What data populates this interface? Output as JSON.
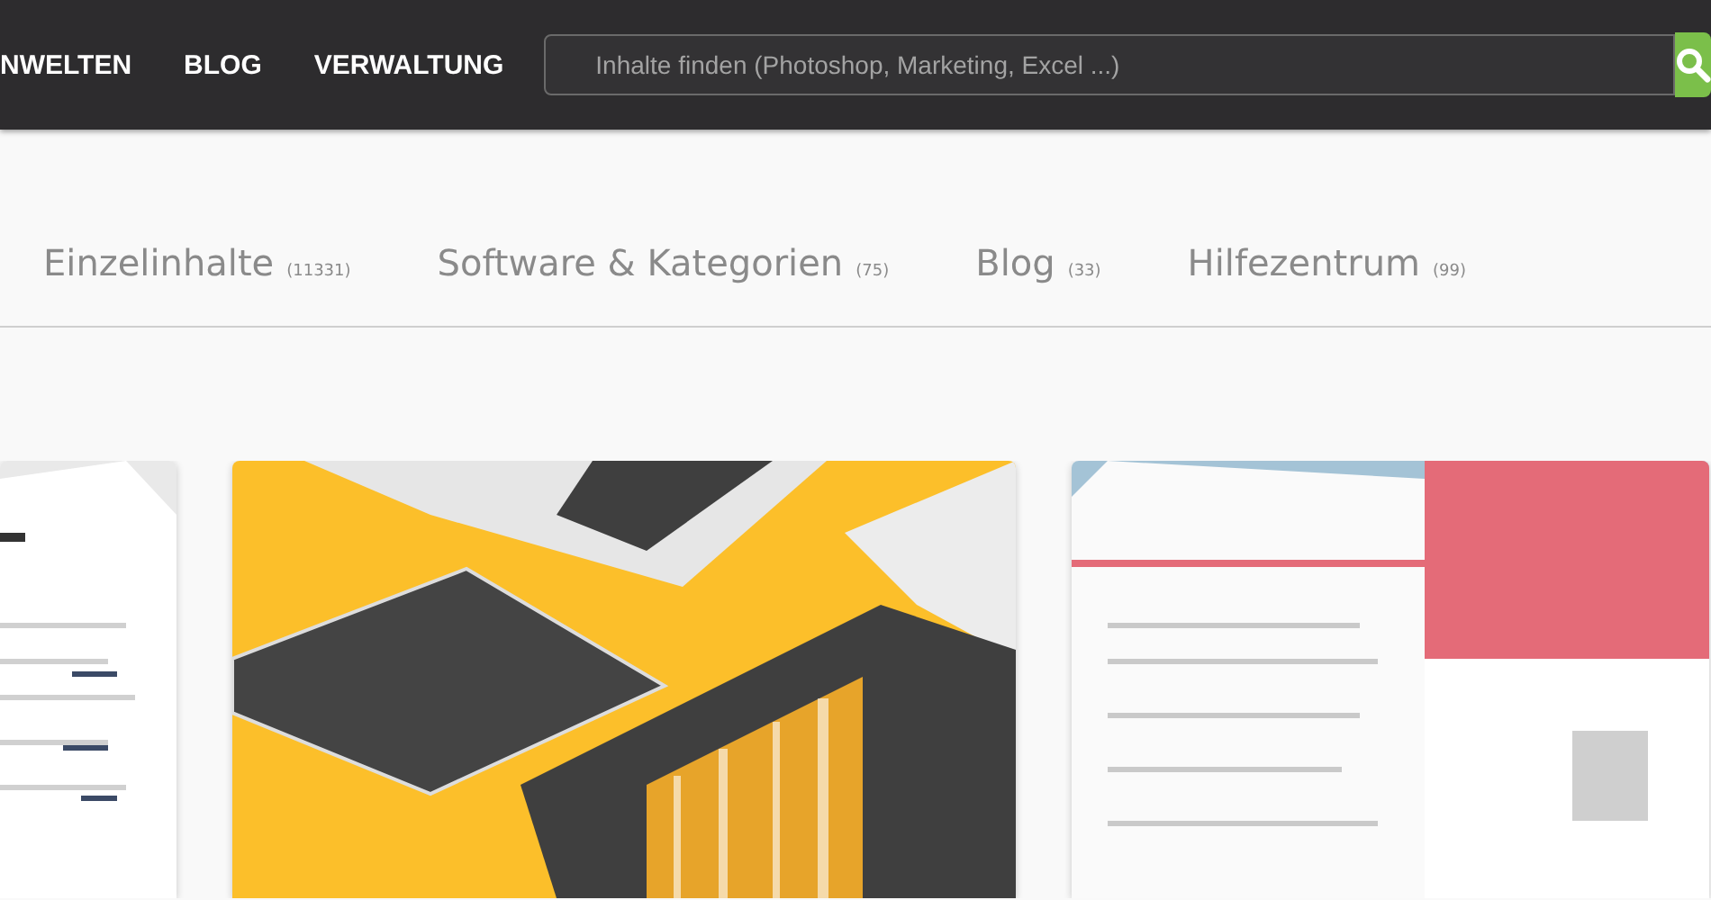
{
  "header": {
    "nav": [
      {
        "label": "NWELTEN"
      },
      {
        "label": "BLOG"
      },
      {
        "label": "VERWALTUNG"
      }
    ],
    "search": {
      "placeholder": "Inhalte finden (Photoshop, Marketing, Excel ...)"
    }
  },
  "tabs": [
    {
      "label": "Einzelinhalte",
      "count": "(11331)",
      "selected": false
    },
    {
      "label": "Software & Kategorien",
      "count": "(75)",
      "selected": false
    },
    {
      "label": "Blog",
      "count": "(33)",
      "selected": false
    },
    {
      "label": "Hilfezentrum",
      "count": "(99)",
      "selected": false
    }
  ],
  "cards": [
    {
      "kind": "resume"
    },
    {
      "kind": "slides"
    },
    {
      "kind": "application"
    }
  ]
}
